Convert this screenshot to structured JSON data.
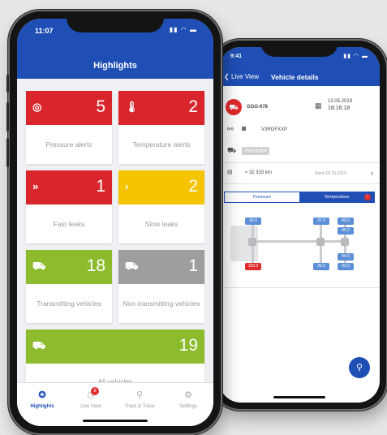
{
  "phone1": {
    "status": {
      "time": "11:07",
      "icons": "▮▮ ◠ ▬"
    },
    "title": "Highlights",
    "tiles": [
      {
        "icon": "◎",
        "number": "5",
        "label": "Pressure alerts",
        "color": "#d9262c"
      },
      {
        "icon": "🌡",
        "number": "2",
        "label": "Temperature alerts",
        "color": "#d9262c"
      },
      {
        "icon": "»",
        "number": "1",
        "label": "Fast leaks",
        "color": "#d9262c"
      },
      {
        "icon": "›",
        "number": "2",
        "label": "Slow leaks",
        "color": "#f5c400"
      },
      {
        "icon": "⛟",
        "number": "18",
        "label": "Transmitting vehicles",
        "color": "#8cbc2e"
      },
      {
        "icon": "⛟",
        "number": "1",
        "label": "Non-transmitting vehicles",
        "color": "#9e9e9e"
      },
      {
        "icon": "⛟",
        "number": "19",
        "label": "All vehicles",
        "color": "#8cbc2e"
      }
    ],
    "tabs": [
      {
        "label": "Highlights",
        "icon": "✪"
      },
      {
        "label": "Live View",
        "icon": "◷",
        "badge": "8"
      },
      {
        "label": "Track & Trace",
        "icon": "⚲"
      },
      {
        "label": "Settings",
        "icon": "⚙"
      }
    ]
  },
  "phone2": {
    "status": {
      "time": "9:41",
      "icons": "▮▮ ◠ ▬"
    },
    "back_label": "Live View",
    "title": "Vehicle details",
    "plate": "GGG-678",
    "date": "13.05.2019",
    "time": "18:16:18",
    "tyre_id": "V3RGFXXP",
    "fleet_tag": "Fleet ppdl A",
    "odometer": "≈ 32 315 km",
    "since": "Since 02.01.2019",
    "seg_pressure": "Pressure",
    "seg_temperature": "Temperature",
    "seg_badge": "!",
    "tyres": {
      "front_left": "36.0",
      "rear_left": "105.0",
      "mid_top": "37.0",
      "mid_bottom": "39.0",
      "r_top1": "40.0",
      "r_top2": "45.0",
      "r_bot1": "44.0",
      "r_bot2": "42.0"
    },
    "fab_icon": "⚲"
  }
}
